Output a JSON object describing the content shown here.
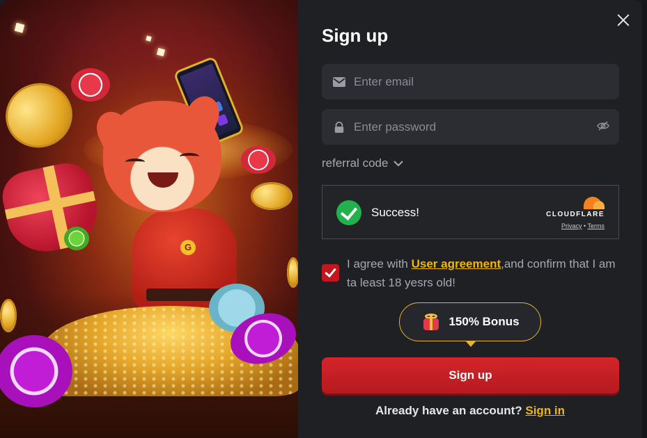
{
  "form": {
    "title": "Sign up",
    "email_placeholder": "Enter email",
    "password_placeholder": "Enter password",
    "referral_label": "referral code",
    "captcha": {
      "status": "Success!",
      "provider": "CLOUDFLARE",
      "privacy_link": "Privacy",
      "separator": "•",
      "terms_link": "Terms"
    },
    "agreement": {
      "checked": true,
      "prefix": "I agree with ",
      "link": "User agreement",
      "suffix": ",and confirm that I am ta least 18 yesrs old!"
    },
    "bonus_label": "150% Bonus",
    "submit_label": "Sign up",
    "signin_prompt": "Already have an account?",
    "signin_link": "Sign in"
  },
  "hero": {
    "character_badge": "G"
  },
  "colors": {
    "accent_red": "#c4161e",
    "link_gold": "#f2b705",
    "panel_bg": "#1f2024",
    "field_bg": "#2b2d33",
    "captcha_success": "#22b14c"
  },
  "icons": {
    "close": "close-icon",
    "email": "envelope-icon",
    "password": "lock-icon",
    "toggle_password": "eye-off-icon",
    "referral_toggle": "chevron-down-icon",
    "captcha": "checkmark-circle-icon",
    "bonus": "gift-box-icon"
  }
}
